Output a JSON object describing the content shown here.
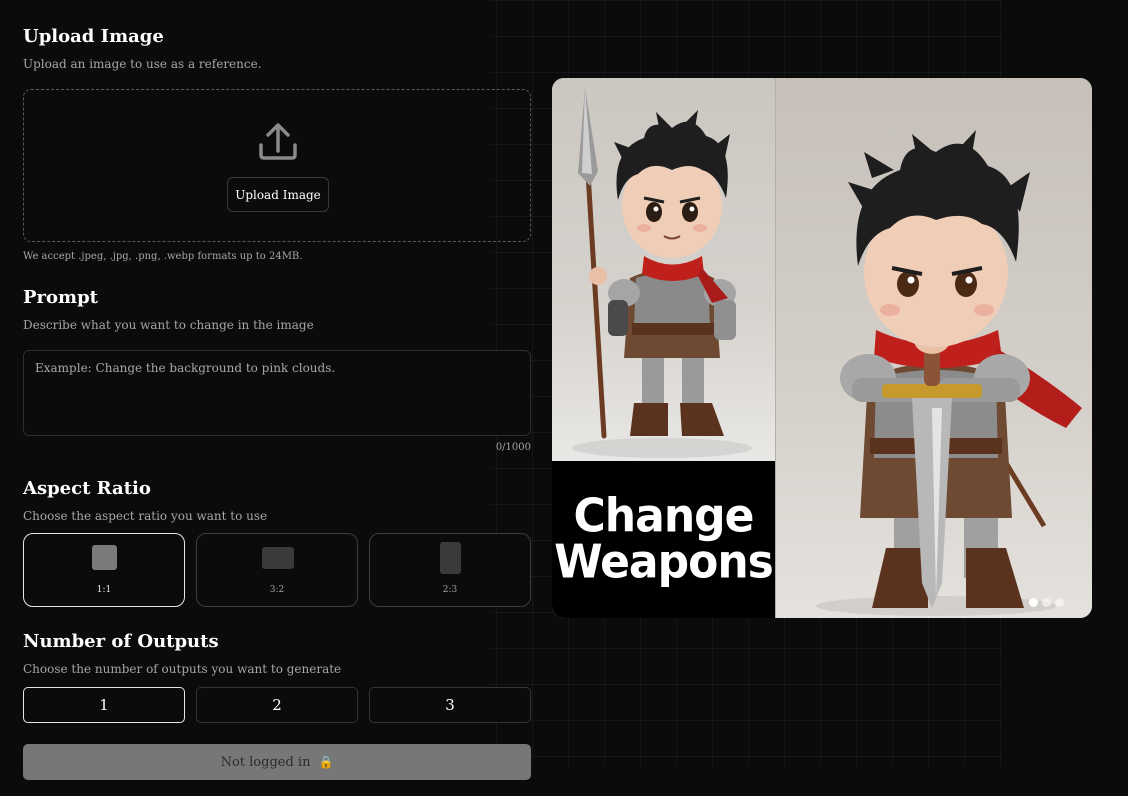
{
  "upload": {
    "title": "Upload Image",
    "subtitle": "Upload an image to use as a reference.",
    "button_label": "Upload Image",
    "note": "We accept .jpeg, .jpg, .png, .webp formats up to 24MB."
  },
  "prompt": {
    "title": "Prompt",
    "subtitle": "Describe what you want to change in the image",
    "placeholder": "Example: Change the background to pink clouds.",
    "value": "",
    "counter": "0/1000"
  },
  "aspect_ratio": {
    "title": "Aspect Ratio",
    "subtitle": "Choose the aspect ratio you want to use",
    "options": [
      {
        "label": "1:1",
        "selected": true
      },
      {
        "label": "3:2",
        "selected": false
      },
      {
        "label": "2:3",
        "selected": false
      }
    ]
  },
  "outputs": {
    "title": "Number of Outputs",
    "subtitle": "Choose the number of outputs you want to generate",
    "options": [
      {
        "label": "1",
        "selected": true
      },
      {
        "label": "2",
        "selected": false
      },
      {
        "label": "3",
        "selected": false
      }
    ]
  },
  "submit": {
    "label": "Not logged in",
    "icon": "lock-icon",
    "icon_glyph": "🔒"
  },
  "showcase": {
    "caption_line1": "Change",
    "caption_line2": "Weapons",
    "slide_count": 3,
    "active_slide": 1
  },
  "colors": {
    "background": "#0b0b0b",
    "submit_disabled": "#777777",
    "scarf_red": "#c0201c"
  }
}
